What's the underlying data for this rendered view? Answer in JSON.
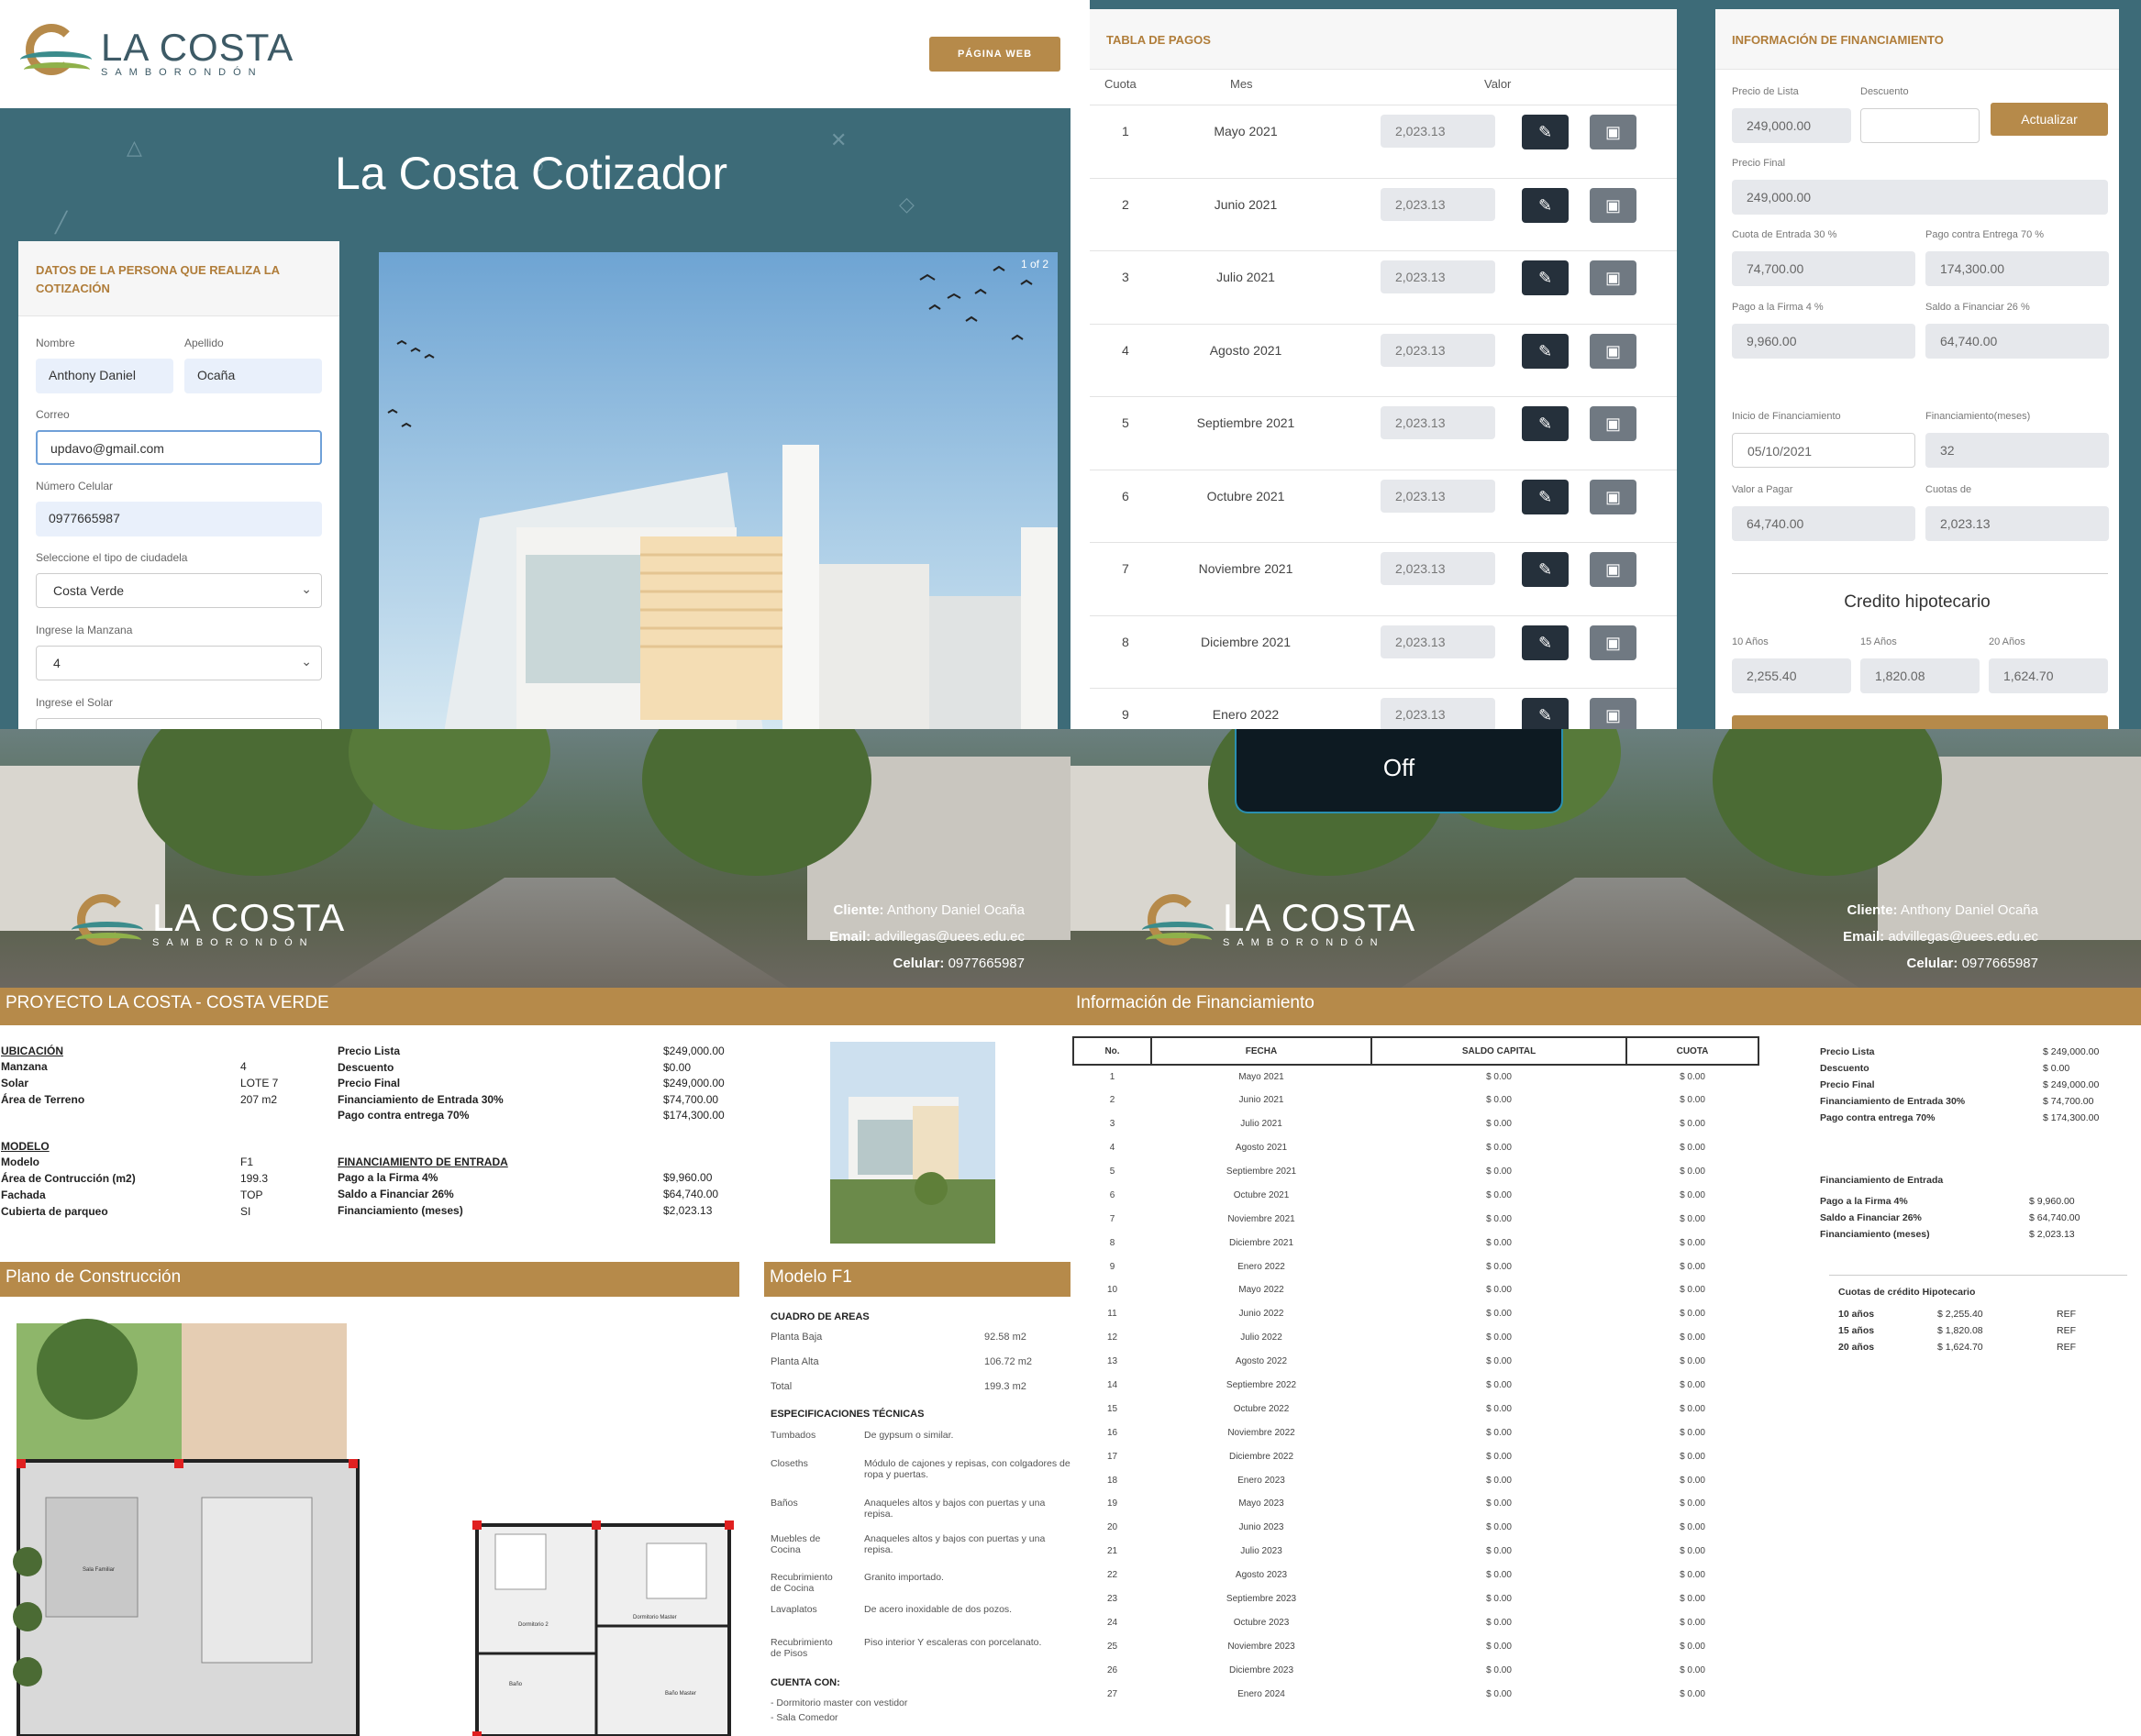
{
  "brand": {
    "name": "LA COSTA",
    "sub": "SAMBORONDÓN"
  },
  "cotizador": {
    "web_button": "PÁGINA WEB",
    "title": "La Costa Cotizador",
    "form_title": "DATOS DE LA PERSONA QUE REALIZA LA COTIZACIÓN",
    "name_label": "Nombre",
    "name_value": "Anthony Daniel",
    "surname_label": "Apellido",
    "surname_value": "Ocaña",
    "email_label": "Correo",
    "email_value": "updavo@gmail.com",
    "phone_label": "Número Celular",
    "phone_value": "0977665987",
    "citadel_label": "Seleccione el tipo de ciudadela",
    "citadel_value": "Costa Verde",
    "block_label": "Ingrese la Manzana",
    "block_value": "4",
    "lot_label": "Ingrese el Solar",
    "carousel_counter": "1 of 2"
  },
  "payments": {
    "title": "TABLA DE PAGOS",
    "headers": {
      "cuota": "Cuota",
      "mes": "Mes",
      "valor": "Valor"
    },
    "rows": [
      {
        "n": "1",
        "mes": "Mayo 2021",
        "valor": "2,023.13"
      },
      {
        "n": "2",
        "mes": "Junio 2021",
        "valor": "2,023.13"
      },
      {
        "n": "3",
        "mes": "Julio 2021",
        "valor": "2,023.13"
      },
      {
        "n": "4",
        "mes": "Agosto 2021",
        "valor": "2,023.13"
      },
      {
        "n": "5",
        "mes": "Septiembre 2021",
        "valor": "2,023.13"
      },
      {
        "n": "6",
        "mes": "Octubre 2021",
        "valor": "2,023.13"
      },
      {
        "n": "7",
        "mes": "Noviembre 2021",
        "valor": "2,023.13"
      },
      {
        "n": "8",
        "mes": "Diciembre 2021",
        "valor": "2,023.13"
      },
      {
        "n": "9",
        "mes": "Enero 2022",
        "valor": "2,023.13"
      }
    ]
  },
  "financing": {
    "title": "INFORMACIÓN DE FINANCIAMIENTO",
    "list_price_label": "Precio de Lista",
    "list_price": "249,000.00",
    "discount_label": "Descuento",
    "discount": "",
    "update_button": "Actualizar",
    "final_price_label": "Precio Final",
    "final_price": "249,000.00",
    "down_label": "Cuota de Entrada 30 %",
    "down": "74,700.00",
    "delivery_label": "Pago contra Entrega 70 %",
    "delivery": "174,300.00",
    "signing_label": "Pago a la Firma 4 %",
    "signing": "9,960.00",
    "balance_label": "Saldo a Financiar 26 %",
    "balance": "64,740.00",
    "start_label": "Inicio de Financiamiento",
    "start": "05/10/2021",
    "months_label": "Financiamiento(meses)",
    "months": "32",
    "pay_label": "Valor a Pagar",
    "pay": "64,740.00",
    "quota_label": "Cuotas de",
    "quota": "2,023.13",
    "mortgage_title": "Credito hipotecario",
    "m10_label": "10 Años",
    "m10": "2,255.40",
    "m15_label": "15 Años",
    "m15": "1,820.08",
    "m20_label": "20 Años",
    "m20": "1,624.70"
  },
  "overlay": {
    "label": "Off"
  },
  "banner": {
    "client_label": "Cliente:",
    "client": "Anthony Daniel Ocaña",
    "email_label": "Email:",
    "email": "advillegas@uees.edu.ec",
    "phone_label": "Celular:",
    "phone": "0977665987"
  },
  "doc": {
    "project_title": "PROYECTO LA COSTA - COSTA VERDE",
    "ubicacion_title": "UBICACIÓN",
    "ubicacion": [
      {
        "k": "Manzana",
        "v": "4"
      },
      {
        "k": "Solar",
        "v": "LOTE 7"
      },
      {
        "k": "Área de Terreno",
        "v": "207 m2"
      }
    ],
    "precios": [
      {
        "k": "Precio Lista",
        "v": "$249,000.00"
      },
      {
        "k": "Descuento",
        "v": "$0.00"
      },
      {
        "k": "Precio Final",
        "v": "$249,000.00"
      },
      {
        "k": "Financiamiento de Entrada 30%",
        "v": "$74,700.00"
      },
      {
        "k": "Pago contra entrega 70%",
        "v": "$174,300.00"
      }
    ],
    "modelo_title": "MODELO",
    "modelo": [
      {
        "k": "Modelo",
        "v": "F1"
      },
      {
        "k": "Área de Contrucción (m2)",
        "v": "199.3"
      },
      {
        "k": "Fachada",
        "v": "TOP"
      },
      {
        "k": "Cubierta de parqueo",
        "v": "SI"
      }
    ],
    "entrada_title": "FINANCIAMIENTO DE ENTRADA",
    "entrada": [
      {
        "k": "Pago a la Firma 4%",
        "v": "$9,960.00"
      },
      {
        "k": "Saldo a Financiar 26%",
        "v": "$64,740.00"
      },
      {
        "k": "Financiamiento (meses)",
        "v": "$2,023.13"
      }
    ],
    "plano_title": "Plano de Construcción",
    "modelo_f1_title": "Modelo F1",
    "areas_title": "CUADRO DE AREAS",
    "areas": [
      {
        "k": "Planta Baja",
        "v": "92.58 m2"
      },
      {
        "k": "Planta Alta",
        "v": "106.72 m2"
      },
      {
        "k": "Total",
        "v": "199.3 m2"
      }
    ],
    "specs_title": "ESPECIFICACIONES TÉCNICAS",
    "specs": [
      {
        "k": "Tumbados",
        "v": "De gypsum o similar."
      },
      {
        "k": "Closeths",
        "v": "Módulo de cajones y repisas, con colgadores de ropa y puertas."
      },
      {
        "k": "Baños",
        "v": "Anaqueles altos y bajos con puertas y una repisa."
      },
      {
        "k": "Muebles de Cocina",
        "v": "Anaqueles altos y bajos con puertas y una repisa."
      },
      {
        "k": "Recubrimiento de Cocina",
        "v": "Granito importado."
      },
      {
        "k": "Lavaplatos",
        "v": "De acero inoxidable de dos pozos."
      },
      {
        "k": "Recubrimiento de Pisos",
        "v": "Piso interior Y escaleras con porcelanato."
      }
    ],
    "cuenta_title": "CUENTA CON:",
    "cuenta": [
      "- Dormitorio master con vestidor",
      "- Sala Comedor"
    ],
    "plan_labels": {
      "sala": "Sala Familiar",
      "dorm2": "Dormitorio 2",
      "master": "Dormitorio Master",
      "bano": "Baño",
      "bano_master": "Baño Master"
    }
  },
  "doc2": {
    "title": "Información de Financiamiento",
    "headers": {
      "no": "No.",
      "fecha": "FECHA",
      "saldo": "SALDO CAPITAL",
      "cuota": "CUOTA"
    },
    "rows": [
      {
        "n": "1",
        "f": "Mayo 2021",
        "s": "$ 0.00",
        "c": "$ 0.00"
      },
      {
        "n": "2",
        "f": "Junio 2021",
        "s": "$ 0.00",
        "c": "$ 0.00"
      },
      {
        "n": "3",
        "f": "Julio 2021",
        "s": "$ 0.00",
        "c": "$ 0.00"
      },
      {
        "n": "4",
        "f": "Agosto 2021",
        "s": "$ 0.00",
        "c": "$ 0.00"
      },
      {
        "n": "5",
        "f": "Septiembre 2021",
        "s": "$ 0.00",
        "c": "$ 0.00"
      },
      {
        "n": "6",
        "f": "Octubre 2021",
        "s": "$ 0.00",
        "c": "$ 0.00"
      },
      {
        "n": "7",
        "f": "Noviembre 2021",
        "s": "$ 0.00",
        "c": "$ 0.00"
      },
      {
        "n": "8",
        "f": "Diciembre 2021",
        "s": "$ 0.00",
        "c": "$ 0.00"
      },
      {
        "n": "9",
        "f": "Enero 2022",
        "s": "$ 0.00",
        "c": "$ 0.00"
      },
      {
        "n": "10",
        "f": "Mayo 2022",
        "s": "$ 0.00",
        "c": "$ 0.00"
      },
      {
        "n": "11",
        "f": "Junio 2022",
        "s": "$ 0.00",
        "c": "$ 0.00"
      },
      {
        "n": "12",
        "f": "Julio 2022",
        "s": "$ 0.00",
        "c": "$ 0.00"
      },
      {
        "n": "13",
        "f": "Agosto 2022",
        "s": "$ 0.00",
        "c": "$ 0.00"
      },
      {
        "n": "14",
        "f": "Septiembre 2022",
        "s": "$ 0.00",
        "c": "$ 0.00"
      },
      {
        "n": "15",
        "f": "Octubre 2022",
        "s": "$ 0.00",
        "c": "$ 0.00"
      },
      {
        "n": "16",
        "f": "Noviembre 2022",
        "s": "$ 0.00",
        "c": "$ 0.00"
      },
      {
        "n": "17",
        "f": "Diciembre 2022",
        "s": "$ 0.00",
        "c": "$ 0.00"
      },
      {
        "n": "18",
        "f": "Enero 2023",
        "s": "$ 0.00",
        "c": "$ 0.00"
      },
      {
        "n": "19",
        "f": "Mayo 2023",
        "s": "$ 0.00",
        "c": "$ 0.00"
      },
      {
        "n": "20",
        "f": "Junio 2023",
        "s": "$ 0.00",
        "c": "$ 0.00"
      },
      {
        "n": "21",
        "f": "Julio 2023",
        "s": "$ 0.00",
        "c": "$ 0.00"
      },
      {
        "n": "22",
        "f": "Agosto 2023",
        "s": "$ 0.00",
        "c": "$ 0.00"
      },
      {
        "n": "23",
        "f": "Septiembre 2023",
        "s": "$ 0.00",
        "c": "$ 0.00"
      },
      {
        "n": "24",
        "f": "Octubre 2023",
        "s": "$ 0.00",
        "c": "$ 0.00"
      },
      {
        "n": "25",
        "f": "Noviembre 2023",
        "s": "$ 0.00",
        "c": "$ 0.00"
      },
      {
        "n": "26",
        "f": "Diciembre 2023",
        "s": "$ 0.00",
        "c": "$ 0.00"
      },
      {
        "n": "27",
        "f": "Enero 2024",
        "s": "$ 0.00",
        "c": "$ 0.00"
      }
    ],
    "summary": [
      {
        "k": "Precio Lista",
        "v": "$ 249,000.00"
      },
      {
        "k": "Descuento",
        "v": "$ 0.00"
      },
      {
        "k": "Precio Final",
        "v": "$ 249,000.00"
      },
      {
        "k": "Financiamiento de Entrada 30%",
        "v": "$ 74,700.00"
      },
      {
        "k": "Pago contra entrega 70%",
        "v": "$ 174,300.00"
      }
    ],
    "entrada_title": "Financiamiento de Entrada",
    "entrada": [
      {
        "k": "Pago a la Firma 4%",
        "v": "$ 9,960.00"
      },
      {
        "k": "Saldo a Financiar 26%",
        "v": "$ 64,740.00"
      },
      {
        "k": "Financiamiento (meses)",
        "v": "$ 2,023.13"
      }
    ],
    "hipo_title": "Cuotas de crédito Hipotecario",
    "hipo": [
      {
        "k": "10 años",
        "v": "$ 2,255.40",
        "r": "REF"
      },
      {
        "k": "15 años",
        "v": "$ 1,820.08",
        "r": "REF"
      },
      {
        "k": "20 años",
        "v": "$ 1,624.70",
        "r": "REF"
      }
    ]
  }
}
